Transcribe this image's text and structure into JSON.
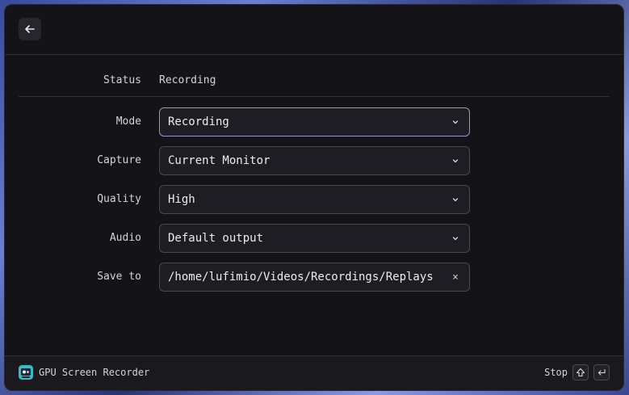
{
  "header": {
    "back_icon": "arrow-left-icon"
  },
  "status": {
    "label": "Status",
    "value": "Recording"
  },
  "form": {
    "mode": {
      "label": "Mode",
      "value": "Recording"
    },
    "capture": {
      "label": "Capture",
      "value": "Current Monitor"
    },
    "quality": {
      "label": "Quality",
      "value": "High"
    },
    "audio": {
      "label": "Audio",
      "value": "Default output"
    },
    "save_to": {
      "label": "Save to",
      "value": "/home/lufimio/Videos/Recordings/Replays",
      "clear_glyph": "×"
    }
  },
  "footer": {
    "app_name": "GPU Screen Recorder",
    "app_icon": "gpu-screen-recorder-logo-icon",
    "action_label": "Stop",
    "shortcut_keys": [
      "shift-icon",
      "enter-icon"
    ]
  },
  "colors": {
    "window_bg": "#141318",
    "field_bg": "#1e1d23",
    "field_border": "#4a4953",
    "focus_border": "#9a96c6",
    "text": "#ececf0"
  }
}
